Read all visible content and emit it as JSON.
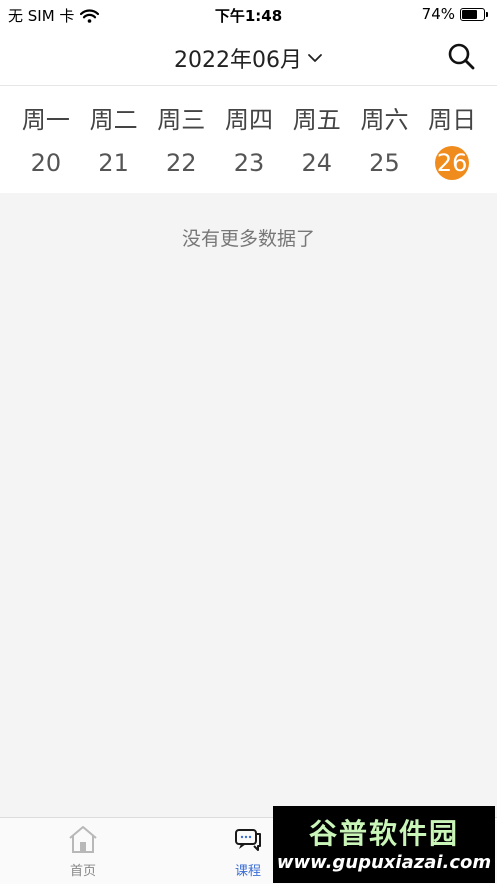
{
  "status_bar": {
    "carrier": "无 SIM 卡",
    "time": "下午1:48",
    "battery": "74%",
    "battery_level": 0.74
  },
  "header": {
    "month_label": "2022年06月",
    "dropdown_icon": "chevron-down-icon",
    "search_icon": "search-icon"
  },
  "week": {
    "days": [
      "周一",
      "周二",
      "周三",
      "周四",
      "周五",
      "周六",
      "周日"
    ],
    "dates": [
      "20",
      "21",
      "22",
      "23",
      "24",
      "25",
      "26"
    ],
    "selected_index": 6,
    "accent_color": "#f08c1e"
  },
  "content": {
    "empty_text": "没有更多数据了"
  },
  "tabbar": {
    "home_label": "首页",
    "course_label": "课程",
    "active_color": "#3d6fd6"
  },
  "watermark": {
    "title": "谷普软件园",
    "url": "www.gupuxiazai.com"
  }
}
